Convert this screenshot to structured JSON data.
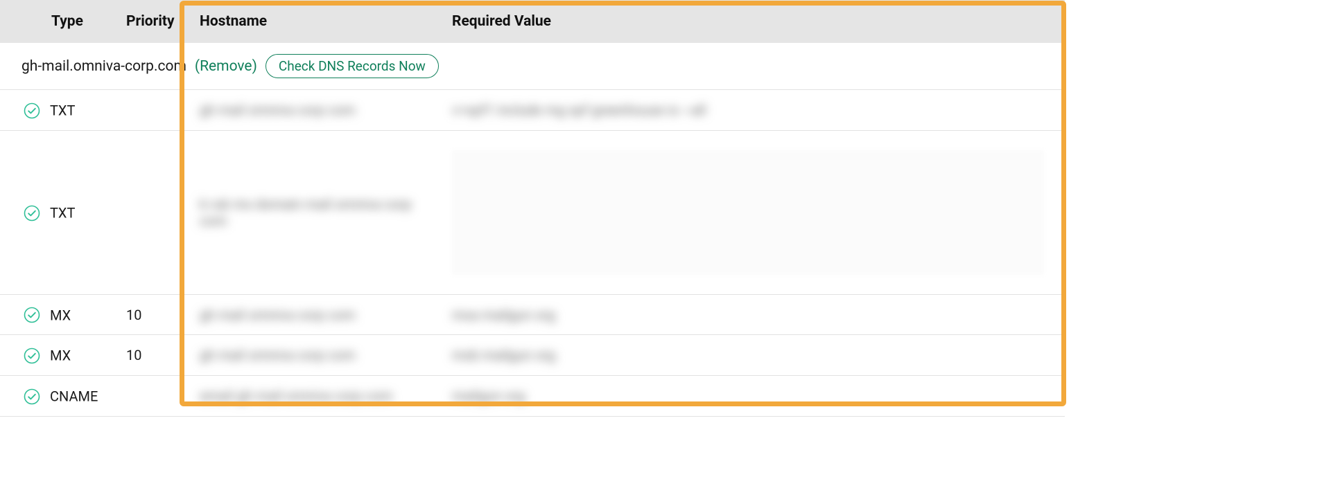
{
  "headers": {
    "type": "Type",
    "priority": "Priority",
    "hostname": "Hostname",
    "required_value": "Required Value"
  },
  "domain_row": {
    "domain": "gh-mail.omniva-corp.com",
    "remove_label": "(Remove)",
    "check_btn": "Check DNS Records Now"
  },
  "records": [
    {
      "type": "TXT",
      "priority": "",
      "host_placeholder": "gh mail omniva corp com",
      "value_placeholder": "v=spf1 include mg spf greenhouse io ~all",
      "tall": false,
      "mosaic": false
    },
    {
      "type": "TXT",
      "priority": "",
      "host_placeholder": "k ruk mx domain mail omniva corp com",
      "value_placeholder": "",
      "tall": true,
      "mosaic": true
    },
    {
      "type": "MX",
      "priority": "10",
      "host_placeholder": "gh mail omniva corp com",
      "value_placeholder": "mxa mailgun org",
      "tall": false,
      "mosaic": false
    },
    {
      "type": "MX",
      "priority": "10",
      "host_placeholder": "gh mail omniva corp com",
      "value_placeholder": "mxb mailgun org",
      "tall": false,
      "mosaic": false
    },
    {
      "type": "CNAME",
      "priority": "",
      "host_placeholder": "email gh mail omniva corp com",
      "value_placeholder": "mailgun org",
      "tall": false,
      "mosaic": false
    }
  ]
}
